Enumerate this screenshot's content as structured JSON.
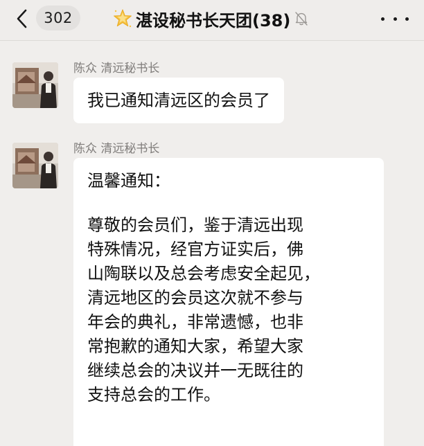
{
  "header": {
    "back_icon": "chevron-left-icon",
    "unread_count": "302",
    "title_icon": "glowing-star-icon",
    "title": "湛设秘书长天团(38)",
    "muted_icon": "bell-off-icon",
    "more_icon": "more-dots-icon"
  },
  "colors": {
    "background": "#f0eeec",
    "bubble": "#ffffff",
    "sender_name": "#7f7c7a",
    "badge_bg": "#e3e1df"
  },
  "messages": [
    {
      "sender": "陈众 清远秘书长",
      "text": "我已通知清远区的会员了"
    },
    {
      "sender": "陈众 清远秘书长",
      "lines": [
        "温馨通知：",
        "尊敬的会员们，鉴于清远出现",
        "特殊情况，经官方证实后，佛",
        "山陶联以及总会考虑安全起见，",
        "清远地区的会员这次就不参与",
        "年会的典礼，非常遗憾，也非",
        "常抱歉的通知大家，希望大家",
        "继续总会的决议并一无既往的",
        "支持总会的工作。"
      ]
    }
  ]
}
